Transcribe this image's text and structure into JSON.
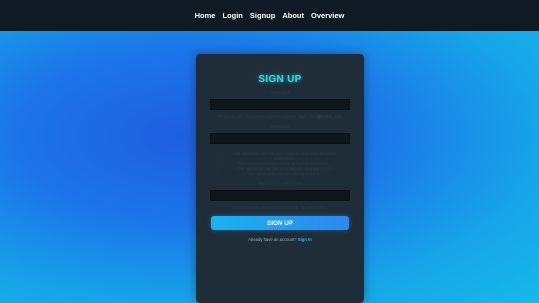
{
  "nav": {
    "items": [
      "Home",
      "Login",
      "Signup",
      "About",
      "Overview"
    ]
  },
  "form": {
    "title": "SIGN UP",
    "username_label": "Username",
    "username_hint_prefix": "Required. 150 characters or fewer. Letters, digits and",
    "username_hint_chars": "@/./+/-/_",
    "username_hint_suffix": "only.",
    "password_label": "Password",
    "password_rules": [
      "Your password can't be too similar to your other personal information.",
      "Your password must contain at least 8 characters.",
      "Your password can't be a commonly used password.",
      "Your password can't be entirely numeric."
    ],
    "confirm_label": "Password confirmation",
    "confirm_hint": "Enter the same password as before, for verification.",
    "submit_label": "SIGN UP",
    "footer_text": "Already have an account?",
    "footer_link": "Sign In"
  },
  "colors": {
    "title": "#33e0ea",
    "nav_bg": "#0f1a24",
    "card_bg": "#1f2d38",
    "button_start": "#19b3f1",
    "button_end": "#2f87ef"
  }
}
